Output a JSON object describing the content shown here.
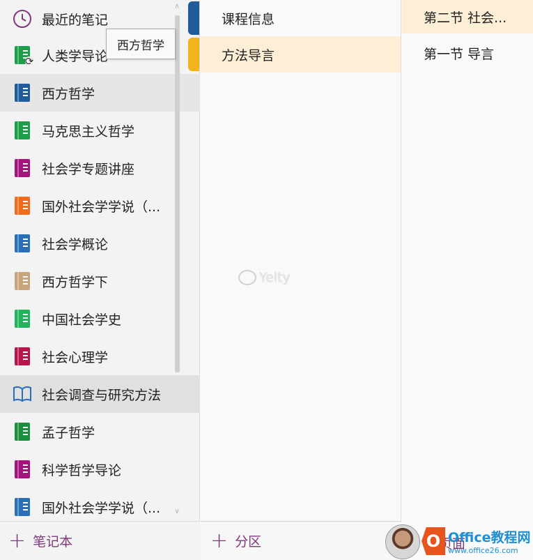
{
  "notebooks": {
    "recent_label": "最近的笔记",
    "tooltip": "西方哲学",
    "items": [
      {
        "label": "人类学导论",
        "color": "#1a9e48",
        "icon": "notebook-sync-icon"
      },
      {
        "label": "西方哲学",
        "color": "#1f5c99",
        "icon": "notebook-icon"
      },
      {
        "label": "马克思主义哲学",
        "color": "#1a9e48",
        "icon": "notebook-icon"
      },
      {
        "label": "社会学专题讲座",
        "color": "#a4137d",
        "icon": "notebook-icon"
      },
      {
        "label": "国外社会学学说（...",
        "color": "#f26a1b",
        "icon": "notebook-icon"
      },
      {
        "label": "社会学概论",
        "color": "#2a6fb5",
        "icon": "notebook-icon"
      },
      {
        "label": "西方哲学下",
        "color": "#c9a57d",
        "icon": "notebook-icon"
      },
      {
        "label": "中国社会学史",
        "color": "#21b45a",
        "icon": "notebook-icon"
      },
      {
        "label": "社会心理学",
        "color": "#b8144d",
        "icon": "notebook-icon"
      },
      {
        "label": "社会调查与研究方法",
        "color": "#2a6fb5",
        "icon": "open-book-icon"
      },
      {
        "label": "孟子哲学",
        "color": "#1a8f3e",
        "icon": "notebook-icon"
      },
      {
        "label": "科学哲学导论",
        "color": "#a4137d",
        "icon": "notebook-icon"
      },
      {
        "label": "国外社会学学说（...",
        "color": "#2a6fb5",
        "icon": "notebook-icon"
      }
    ],
    "add_label": "笔记本"
  },
  "sections": {
    "items": [
      {
        "label": "课程信息",
        "tab_color": "#1f5c99"
      },
      {
        "label": "方法导言",
        "tab_color": "#f2b41c"
      }
    ],
    "add_label": "分区"
  },
  "pages": {
    "items": [
      {
        "label": "第二节 社会..."
      },
      {
        "label": "第一节 导言"
      }
    ],
    "add_label_partial": "页面"
  },
  "watermark": "Yelty",
  "brand": {
    "name": "Office教程网",
    "url": "www.office26.com",
    "logo_letter": "O"
  },
  "colors": {
    "accent": "#80397b",
    "active_section": "#fcefd6",
    "recent_icon": "#80397b"
  }
}
